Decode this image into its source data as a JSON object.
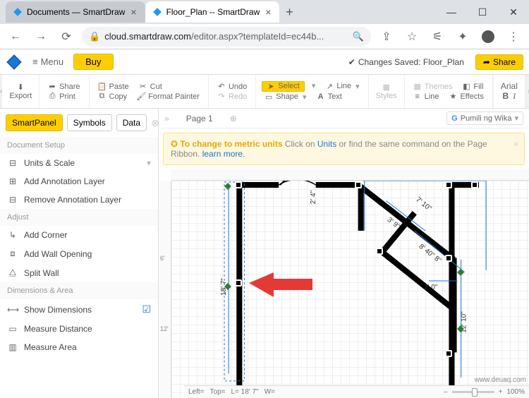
{
  "browser": {
    "tabs": [
      {
        "title": "Documents — SmartDraw"
      },
      {
        "title": "Floor_Plan -- SmartDraw"
      }
    ],
    "url_host": "cloud.smartdraw.com",
    "url_path": "/editor.aspx?templateId=ec44b..."
  },
  "app": {
    "menu": "Menu",
    "buy": "Buy",
    "save_status": "Changes Saved: Floor_Plan",
    "share": "Share"
  },
  "ribbon": {
    "export": "Export",
    "share": "Share",
    "print": "Print",
    "paste": "Paste",
    "copy": "Copy",
    "cut": "Cut",
    "format_painter": "Format Painter",
    "undo": "Undo",
    "redo": "Redo",
    "select": "Select",
    "shape": "Shape",
    "line": "Line",
    "text": "Text",
    "styles": "Styles",
    "themes": "Themes",
    "line2": "Line",
    "fill": "Fill",
    "effects": "Effects",
    "font": "Arial",
    "bold": "B",
    "italic": "I"
  },
  "side": {
    "tabs": {
      "smartpanel": "SmartPanel",
      "symbols": "Symbols",
      "data": "Data"
    },
    "section_setup": "Document Setup",
    "units_scale": "Units & Scale",
    "add_annotation": "Add Annotation Layer",
    "remove_annotation": "Remove Annotation Layer",
    "section_adjust": "Adjust",
    "add_corner": "Add Corner",
    "add_opening": "Add Wall Opening",
    "split_wall": "Split Wall",
    "section_dims": "Dimensions & Area",
    "show_dims": "Show Dimensions",
    "measure_dist": "Measure Distance",
    "measure_area": "Measure Area"
  },
  "page": {
    "name": "Page 1",
    "lang": "Pumili ng Wika"
  },
  "banner": {
    "prefix_bold": "To change to metric units",
    "mid1": " Click on ",
    "link1": "Units",
    "mid2": " or find the same command on the Page Ribbon. ",
    "link2": "learn more."
  },
  "dims": {
    "d1": "2' 4\"",
    "d2": "7' 10\"",
    "d3": "3' 9\"",
    "d4": "8' 40\" 8\"",
    "d5": "2' 0\"",
    "d6": "12' 10\"",
    "d7": "18' 7\""
  },
  "ruler": {
    "v6": "6'",
    "v12": "12'"
  },
  "status": {
    "left": "Left=",
    "top": "Top=",
    "l": "L= 18' 7\"",
    "w": "W="
  },
  "zoom": "100%",
  "watermark": "www.deuaq.com"
}
